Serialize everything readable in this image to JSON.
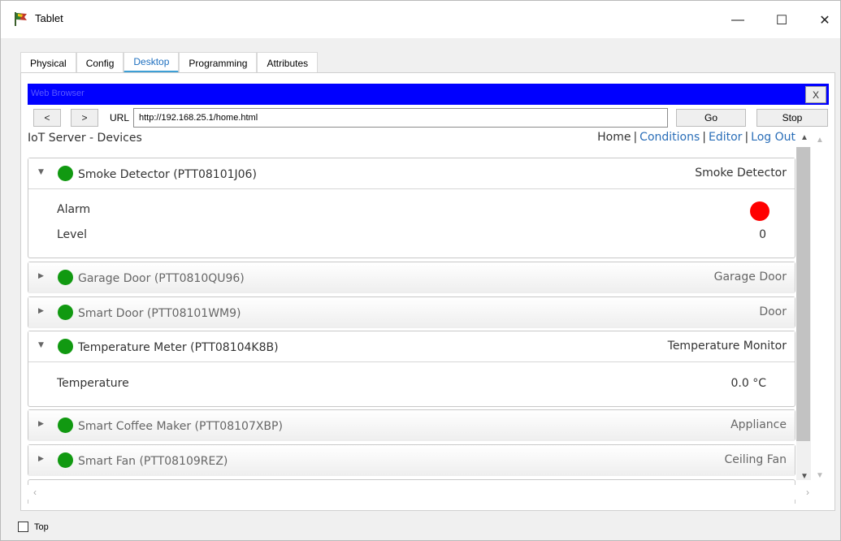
{
  "window": {
    "title": "Tablet",
    "minimize_symbol": "—",
    "maximize_symbol": "☐",
    "close_symbol": "✕"
  },
  "tabs": [
    {
      "label": "Physical",
      "active": false
    },
    {
      "label": "Config",
      "active": false
    },
    {
      "label": "Desktop",
      "active": true
    },
    {
      "label": "Programming",
      "active": false
    },
    {
      "label": "Attributes",
      "active": false
    }
  ],
  "browser": {
    "title": "Web Browser",
    "close_label": "X",
    "back_label": "<",
    "forward_label": ">",
    "url_label": "URL",
    "url_value": "http://192.168.25.1/home.html",
    "go_label": "Go",
    "stop_label": "Stop"
  },
  "page": {
    "title": "IoT Server - Devices",
    "nav": {
      "home": "Home",
      "conditions": "Conditions",
      "editor": "Editor",
      "logout": "Log Out",
      "separator": "|"
    }
  },
  "devices": [
    {
      "name": "Smoke Detector (PTT08101J06)",
      "type": "Smoke Detector",
      "expanded": true,
      "status_color": "#119911",
      "rows": [
        {
          "label": "Alarm",
          "value": "",
          "indicator_color": "#ff0000"
        },
        {
          "label": "Level",
          "value": "0"
        }
      ]
    },
    {
      "name": "Garage Door (PTT0810QU96)",
      "type": "Garage Door",
      "expanded": false,
      "status_color": "#119911"
    },
    {
      "name": "Smart Door (PTT08101WM9)",
      "type": "Door",
      "expanded": false,
      "status_color": "#119911"
    },
    {
      "name": "Temperature Meter (PTT08104K8B)",
      "type": "Temperature Monitor",
      "expanded": true,
      "status_color": "#119911",
      "rows": [
        {
          "label": "Temperature",
          "value": "0.0 °C"
        }
      ]
    },
    {
      "name": "Smart Coffee Maker (PTT08107XBP)",
      "type": "Appliance",
      "expanded": false,
      "status_color": "#119911"
    },
    {
      "name": "Smart Fan (PTT08109REZ)",
      "type": "Ceiling Fan",
      "expanded": false,
      "status_color": "#119911"
    }
  ],
  "footer": {
    "top_label": "Top",
    "top_checked": false
  },
  "icons": {
    "expanded_arrow": "▼",
    "collapsed_arrow": "▶",
    "scroll_up": "▲",
    "scroll_down": "▼",
    "scroll_left": "‹",
    "scroll_right": "›"
  }
}
